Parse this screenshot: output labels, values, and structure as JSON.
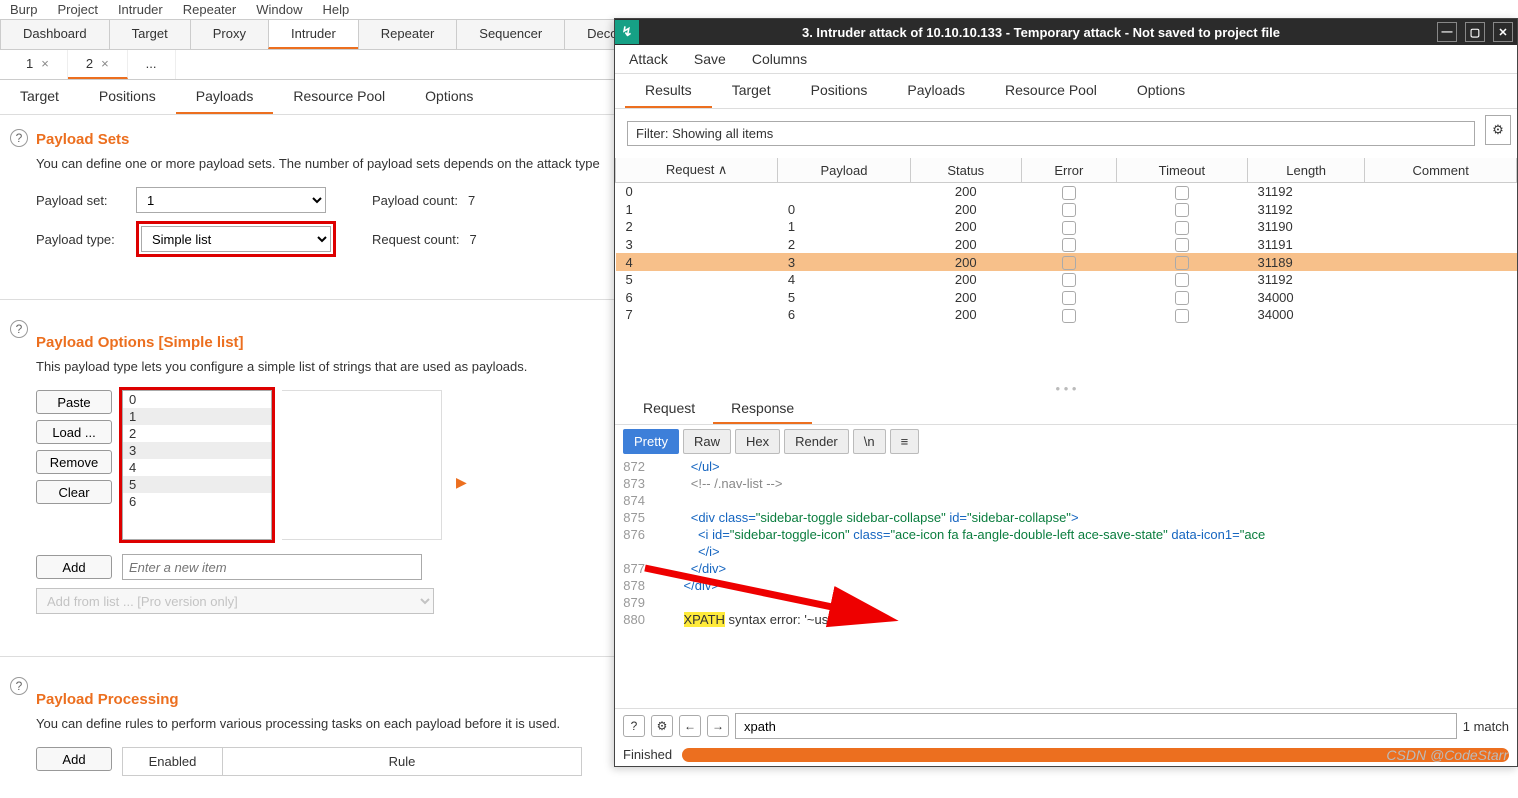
{
  "menubar": [
    "Burp",
    "Project",
    "Intruder",
    "Repeater",
    "Window",
    "Help"
  ],
  "main_tabs": [
    "Dashboard",
    "Target",
    "Proxy",
    "Intruder",
    "Repeater",
    "Sequencer",
    "Decoder"
  ],
  "main_tab_active": 3,
  "sub_tabs": [
    {
      "label": "1",
      "close": "×"
    },
    {
      "label": "2",
      "close": "×"
    },
    {
      "label": "..."
    }
  ],
  "sub_tab_active": 1,
  "inner_tabs": [
    "Target",
    "Positions",
    "Payloads",
    "Resource Pool",
    "Options"
  ],
  "inner_tab_active": 2,
  "payload_sets": {
    "title": "Payload Sets",
    "desc": "You can define one or more payload sets. The number of payload sets depends on the attack type",
    "set_label": "Payload set:",
    "set_value": "1",
    "type_label": "Payload type:",
    "type_value": "Simple list",
    "payload_count_label": "Payload count:",
    "payload_count_value": "7",
    "request_count_label": "Request count:",
    "request_count_value": "7"
  },
  "payload_options": {
    "title": "Payload Options [Simple list]",
    "desc": "This payload type lets you configure a simple list of strings that are used as payloads.",
    "buttons": {
      "paste": "Paste",
      "load": "Load ...",
      "remove": "Remove",
      "clear": "Clear",
      "add": "Add"
    },
    "items": [
      "0",
      "1",
      "2",
      "3",
      "4",
      "5",
      "6"
    ],
    "add_placeholder": "Enter a new item",
    "add_from_list": "Add from list ... [Pro version only]"
  },
  "payload_processing": {
    "title": "Payload Processing",
    "desc": "You can define rules to perform various processing tasks on each payload before it is used.",
    "add": "Add",
    "enabled": "Enabled",
    "rule": "Rule"
  },
  "attack": {
    "title": "3. Intruder attack of 10.10.10.133 - Temporary attack - Not saved to project file",
    "menu": [
      "Attack",
      "Save",
      "Columns"
    ],
    "tabs": [
      "Results",
      "Target",
      "Positions",
      "Payloads",
      "Resource Pool",
      "Options"
    ],
    "tab_active": 0,
    "filter_label": "Filter: Showing all items",
    "columns": [
      "Request",
      "Payload",
      "Status",
      "Error",
      "Timeout",
      "Length",
      "Comment"
    ],
    "sort_col": 0,
    "rows": [
      {
        "req": "0",
        "payload": "",
        "status": "200",
        "len": "31192"
      },
      {
        "req": "1",
        "payload": "0",
        "status": "200",
        "len": "31192"
      },
      {
        "req": "2",
        "payload": "1",
        "status": "200",
        "len": "31190"
      },
      {
        "req": "3",
        "payload": "2",
        "status": "200",
        "len": "31191"
      },
      {
        "req": "4",
        "payload": "3",
        "status": "200",
        "len": "31189",
        "sel": true
      },
      {
        "req": "5",
        "payload": "4",
        "status": "200",
        "len": "31192"
      },
      {
        "req": "6",
        "payload": "5",
        "status": "200",
        "len": "34000"
      },
      {
        "req": "7",
        "payload": "6",
        "status": "200",
        "len": "34000"
      }
    ],
    "rr_tabs": [
      "Request",
      "Response"
    ],
    "rr_active": 1,
    "view_tabs": [
      "Pretty",
      "Raw",
      "Hex",
      "Render"
    ],
    "view_active": 0,
    "newline_btn": "\\n",
    "code_start": 872,
    "code_lines": [
      {
        "n": "872",
        "html": "           <span class='c-tag'>&lt;/ul&gt;</span>"
      },
      {
        "n": "873",
        "html": "           <span class='c-comm'>&lt;!-- /.nav-list --&gt;</span>"
      },
      {
        "n": "874",
        "html": ""
      },
      {
        "n": "875",
        "html": "           <span class='c-tag'>&lt;div</span> <span class='c-attr'>class=</span><span class='c-val'>\"sidebar-toggle sidebar-collapse\"</span> <span class='c-attr'>id=</span><span class='c-val'>\"sidebar-collapse\"</span><span class='c-tag'>&gt;</span>"
      },
      {
        "n": "876",
        "html": "             <span class='c-tag'>&lt;i</span> <span class='c-attr'>id=</span><span class='c-val'>\"sidebar-toggle-icon\"</span> <span class='c-attr'>class=</span><span class='c-val'>\"ace-icon fa fa-angle-double-left ace-save-state\"</span> <span class='c-attr'>data-icon1=</span><span class='c-val'>\"ace</span>"
      },
      {
        "n": "",
        "html": "             <span class='c-tag'>&lt;/i&gt;</span>"
      },
      {
        "n": "877",
        "html": "           <span class='c-tag'>&lt;/div&gt;</span>"
      },
      {
        "n": "878",
        "html": "         <span class='c-tag'>&lt;/div&gt;</span>"
      },
      {
        "n": "879",
        "html": ""
      },
      {
        "n": "880",
        "html": "         <span class='hl'>XPATH</span> syntax error: '~users'"
      }
    ],
    "search_value": "xpath",
    "match_text": "1 match",
    "status_text": "Finished"
  },
  "watermark": "CSDN @CodeStarr"
}
